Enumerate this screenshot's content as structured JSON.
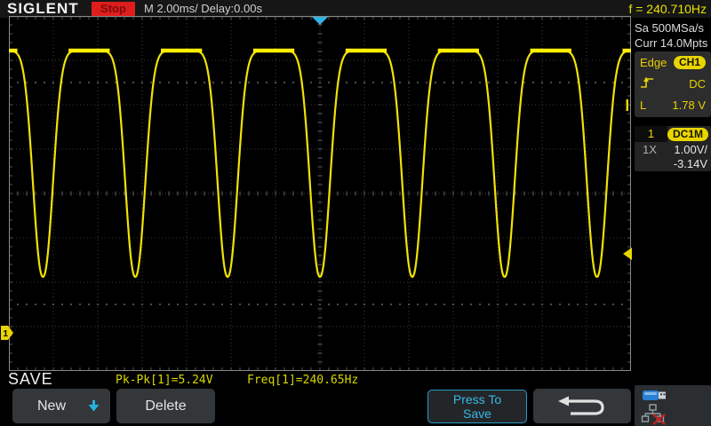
{
  "header": {
    "brand": "SIGLENT",
    "acq_status": "Stop",
    "timebase": "M 2.00ms/ Delay:0.00s",
    "freq_counter": "f = 240.710Hz"
  },
  "sidebar": {
    "sample_rate": "Sa 500MSa/s",
    "memory_depth": "Curr 14.0Mpts",
    "trigger": {
      "type_label": "Edge",
      "source_badge": "CH1",
      "slope_icon": "rising-edge-icon",
      "coupling": "DC",
      "level_label": "L",
      "level_value": "1.78 V"
    },
    "channel": {
      "number": "1",
      "coupling_badge": "DC1M",
      "probe_atten": "1X",
      "volts_per_div": "1.00V/",
      "offset": "-3.14V"
    }
  },
  "footer": {
    "menu_title": "SAVE",
    "measurements": [
      {
        "label": "Pk-Pk[1]=5.24V"
      },
      {
        "label": "Freq[1]=240.65Hz"
      }
    ],
    "buttons": {
      "new_label": "New",
      "delete_label": "Delete",
      "press_to_save_line1": "Press To",
      "press_to_save_line2": "Save"
    },
    "status_icons": {
      "usb": "usb-device-connected",
      "lan": "lan-disconnected"
    }
  },
  "colors": {
    "trace_yellow": "#f0e206",
    "trace_bright": "#ffee00",
    "accent_yellow": "#e8d500",
    "accent_cyan": "#2fb3e0",
    "stop_red": "#df1d1d"
  },
  "chart_data": {
    "type": "line",
    "title": "CH1 waveform",
    "waveform_shape": "flat-topped positive signal with one narrow rounded negative dip per period",
    "series": [
      {
        "name": "CH1",
        "color": "#f0e206"
      }
    ],
    "h_divisions": 14,
    "v_divisions": 8,
    "timebase_ms_per_div": 2.0,
    "trigger_delay_ms": 0.0,
    "volts_per_div": 1.0,
    "channel_offset_v": -3.14,
    "trigger_level_v": 1.78,
    "frequency_hz": 240.65,
    "pk_pk_v": 5.24,
    "period_ms": 4.1554,
    "flat_top_v": 6.36,
    "valley_min_v": 1.26,
    "dip_sigma_ms": 0.6,
    "dip_exponent": 2.2,
    "sample_rate": "500MSa/s",
    "memory_depth": "14.0Mpts"
  }
}
